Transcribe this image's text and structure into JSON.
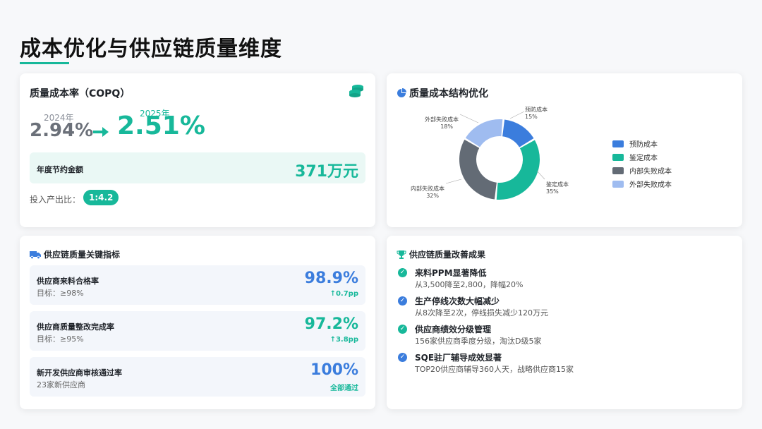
{
  "page": {
    "title": "成本优化与供应链质量维度"
  },
  "copq": {
    "title": "质量成本率（COPQ）",
    "icon": "coins-icon",
    "year_old": "2024年",
    "value_old": "2.94%",
    "year_new": "2025年",
    "value_new": "2.51%",
    "saving_label": "年度节约金额",
    "saving_value": "371万元",
    "roi_label": "投入产出比：",
    "roi_value": "1:4.2"
  },
  "structure": {
    "title": "质量成本结构优化",
    "icon": "pie-chart-icon",
    "slice_labels": [
      {
        "name": "预防成本",
        "pct": "15%"
      },
      {
        "name": "鉴定成本",
        "pct": "35%"
      },
      {
        "name": "内部失败成本",
        "pct": "32%"
      },
      {
        "name": "外部失败成本",
        "pct": "18%"
      }
    ]
  },
  "chart_data": {
    "type": "pie",
    "categories": [
      "预防成本",
      "鉴定成本",
      "内部失败成本",
      "外部失败成本"
    ],
    "values": [
      15,
      35,
      32,
      18
    ],
    "colors": [
      "#3b7ddd",
      "#17b89a",
      "#636b75",
      "#9fbcf0"
    ],
    "legend_position": "right"
  },
  "kpi": {
    "title": "供应链质量关键指标",
    "icon": "truck-icon",
    "rows": [
      {
        "name": "供应商来料合格率",
        "sub": "目标：≥98%",
        "value": "98.9%",
        "delta": "↑0.7pp",
        "color": "#3b7ddd"
      },
      {
        "name": "供应商质量整改完成率",
        "sub": "目标：≥95%",
        "value": "97.2%",
        "delta": "↑3.8pp",
        "color": "#17b89a"
      },
      {
        "name": "新开发供应商审核通过率",
        "sub": "23家新供应商",
        "value": "100%",
        "delta": "全部通过",
        "color": "#3b7ddd"
      }
    ]
  },
  "improve": {
    "title": "供应链质量改善成果",
    "icon": "trophy-icon",
    "items": [
      {
        "title": "来料PPM显著降低",
        "desc": "从3,500降至2,800，降幅20%",
        "color": "#17b89a"
      },
      {
        "title": "生产停线次数大幅减少",
        "desc": "从8次降至2次，停线损失减少120万元",
        "color": "#3b7ddd"
      },
      {
        "title": "供应商绩效分级管理",
        "desc": "156家供应商季度分级，淘汰D级5家",
        "color": "#17b89a"
      },
      {
        "title": "SQE驻厂辅导成效显著",
        "desc": "TOP20供应商辅导360人天，战略供应商15家",
        "color": "#3b7ddd"
      }
    ]
  }
}
